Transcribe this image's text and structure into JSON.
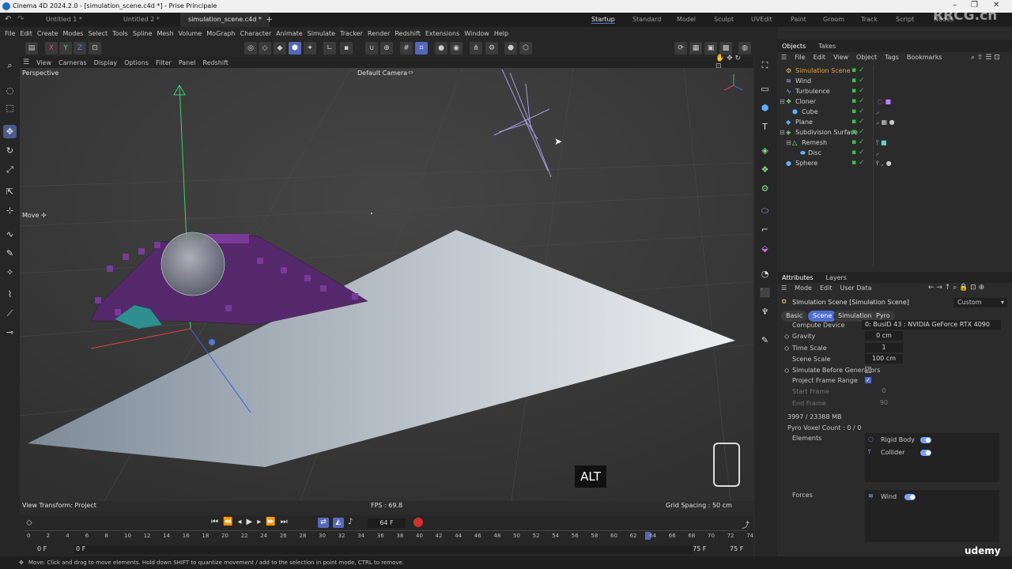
{
  "window": {
    "title": "Cinema 4D 2024.2.0 - [simulation_scene.c4d *] - Prise Principale"
  },
  "doc_tabs": [
    "Untitled 1 *",
    "Untitled 2 *",
    "simulation_scene.c4d *"
  ],
  "layouts": [
    "Startup",
    "Standard",
    "Model",
    "Sculpt",
    "UVEdit",
    "Paint",
    "Groom",
    "Track",
    "Script",
    "Nodes"
  ],
  "menu": [
    "File",
    "Edit",
    "Create",
    "Modes",
    "Select",
    "Tools",
    "Spline",
    "Mesh",
    "Volume",
    "MoGraph",
    "Character",
    "Animate",
    "Simulate",
    "Tracker",
    "Render",
    "Redshift",
    "Extensions",
    "Window",
    "Help"
  ],
  "axis_lock": {
    "x": "X",
    "y": "Y",
    "z": "Z"
  },
  "viewport": {
    "menu": [
      "View",
      "Cameras",
      "Display",
      "Options",
      "Filter",
      "Panel",
      "Redshift"
    ],
    "name": "Perspective",
    "camera": "Default Camera",
    "move_label": "Move ✢",
    "view_transform": "View Transform: Project",
    "fps": "FPS : 69.8",
    "grid_spacing": "Grid Spacing : 50 cm",
    "key_hint": "ALT"
  },
  "timeline": {
    "current_frame": "64 F",
    "start": "0 F",
    "start2": "0 F",
    "end": "75 F",
    "end2": "75 F",
    "ticks": [
      "0",
      "2",
      "4",
      "6",
      "8",
      "10",
      "12",
      "14",
      "16",
      "18",
      "20",
      "22",
      "24",
      "26",
      "28",
      "30",
      "32",
      "34",
      "36",
      "38",
      "40",
      "42",
      "44",
      "46",
      "48",
      "50",
      "52",
      "54",
      "56",
      "58",
      "60",
      "62",
      "64",
      "66",
      "68",
      "70",
      "72",
      "74"
    ]
  },
  "objects_panel": {
    "tabs": [
      "Objects",
      "Takes"
    ],
    "menu": [
      "File",
      "Edit",
      "View",
      "Object",
      "Tags",
      "Bookmarks"
    ],
    "items": [
      {
        "name": "Simulation Scene",
        "depth": 0,
        "highlight": true
      },
      {
        "name": "Wind",
        "depth": 0
      },
      {
        "name": "Turbulence",
        "depth": 0
      },
      {
        "name": "Cloner",
        "depth": 0
      },
      {
        "name": "Cube",
        "depth": 1
      },
      {
        "name": "Plane",
        "depth": 0
      },
      {
        "name": "Subdivision Surface",
        "depth": 0
      },
      {
        "name": "Remesh",
        "depth": 1
      },
      {
        "name": "Disc",
        "depth": 2
      },
      {
        "name": "Sphere",
        "depth": 0
      }
    ]
  },
  "attributes_panel": {
    "tabs": [
      "Attributes",
      "Layers"
    ],
    "menu": [
      "Mode",
      "Edit",
      "User Data"
    ],
    "header": "Simulation Scene [Simulation Scene]",
    "preset": "Custom",
    "subtabs": [
      "Basic",
      "Scene",
      "Simulation",
      "Pyro"
    ],
    "active_subtab": "Scene",
    "compute_device_label": "Compute Device",
    "compute_device": "0: BusID 43 : NVIDIA GeForce RTX 4090",
    "gravity_label": "Gravity",
    "gravity": "0 cm",
    "time_scale_label": "Time Scale",
    "time_scale": "1",
    "scene_scale_label": "Scene Scale",
    "scene_scale": "100 cm",
    "simulate_before_label": "Simulate Before Generators",
    "project_frame_label": "Project Frame Range",
    "start_frame_label": "Start Frame",
    "start_frame": "0",
    "end_frame_label": "End Frame",
    "end_frame": "90",
    "memory": "3997 / 23388 MB",
    "voxel": "Pyro Voxel Count : 0 / 0",
    "elements_label": "Elements",
    "elements": [
      "Rigid Body",
      "Collider"
    ],
    "forces_label": "Forces",
    "forces": [
      "Wind"
    ]
  },
  "status": "Move: Click and drag to move elements. Hold down SHIFT to quantize movement / add to the selection in point mode, CTRL to remove.",
  "watermark": {
    "site": "RRCG.cn",
    "udemy": "udemy"
  },
  "colors": {
    "accent": "#4f6dd1",
    "check": "#3cc050",
    "cubes": "#5a2a70"
  }
}
